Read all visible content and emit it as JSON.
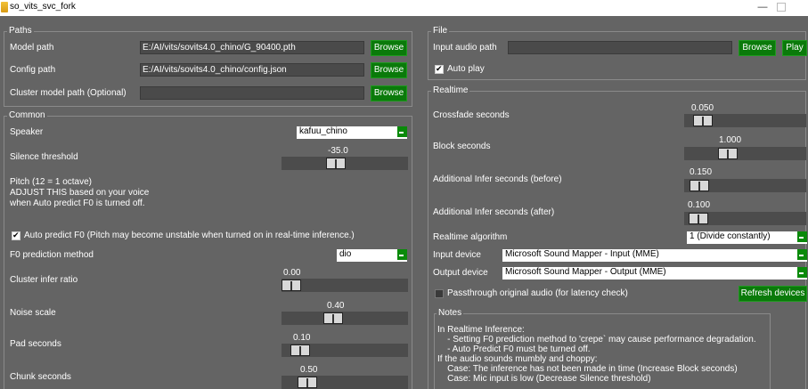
{
  "window": {
    "title": "so_vits_svc_fork",
    "minimize_glyph": "—"
  },
  "paths": {
    "title": "Paths",
    "model_path": {
      "label": "Model path",
      "value": "E:/AI/vits/sovits4.0_chino/G_90400.pth",
      "browse": "Browse"
    },
    "config_path": {
      "label": "Config path",
      "value": "E:/AI/vits/sovits4.0_chino/config.json",
      "browse": "Browse"
    },
    "cluster_model_path": {
      "label": "Cluster model path (Optional)",
      "value": "",
      "browse": "Browse"
    }
  },
  "common": {
    "title": "Common",
    "speaker": {
      "label": "Speaker",
      "value": "kafuu_chino"
    },
    "silence_threshold": {
      "label": "Silence threshold",
      "value": "-35.0",
      "fraction": 0.34
    },
    "pitch": {
      "line1": "Pitch (12 = 1 octave)",
      "line2": "ADJUST THIS based on your voice",
      "line3": "when Auto predict F0 is turned off."
    },
    "auto_predict_f0": {
      "label": "Auto predict F0 (Pitch may become unstable when turned on in real-time inference.)",
      "checked": true
    },
    "f0_method": {
      "label": "F0 prediction method",
      "value": "dio"
    },
    "cluster_infer_ratio": {
      "label": "Cluster infer ratio",
      "value": "0.00",
      "fraction": 0.0
    },
    "noise_scale": {
      "label": "Noise scale",
      "value": "0.40",
      "fraction": 0.4
    },
    "pad_seconds": {
      "label": "Pad seconds",
      "value": "0.10",
      "fraction": 0.08
    },
    "chunk_seconds": {
      "label": "Chunk seconds",
      "value": "0.50",
      "fraction": 0.14
    }
  },
  "file": {
    "title": "File",
    "input_audio_path": {
      "label": "Input audio path",
      "value": "",
      "browse": "Browse",
      "play": "Play"
    },
    "auto_play": {
      "label": "Auto play",
      "checked": true
    }
  },
  "realtime": {
    "title": "Realtime",
    "crossfade": {
      "label": "Crossfade seconds",
      "value": "0.050",
      "fraction": 0.05
    },
    "block": {
      "label": "Block seconds",
      "value": "1.000",
      "fraction": 0.25
    },
    "infer_before": {
      "label": "Additional Infer seconds (before)",
      "value": "0.150",
      "fraction": 0.0
    },
    "infer_after": {
      "label": "Additional Infer seconds (after)",
      "value": "0.100",
      "fraction": 0.0
    },
    "algorithm": {
      "label": "Realtime algorithm",
      "value": "1 (Divide constantly)"
    },
    "input_device": {
      "label": "Input device",
      "value": "Microsoft Sound Mapper - Input (MME)"
    },
    "output_device": {
      "label": "Output device",
      "value": "Microsoft Sound Mapper - Output (MME)"
    },
    "passthrough": {
      "label": "Passthrough original audio (for latency check)",
      "checked": false
    },
    "refresh": "Refresh devices"
  },
  "notes": {
    "title": "Notes",
    "lines": [
      "In Realtime Inference:",
      "    - Setting F0 prediction method to 'crepe` may cause performance degradation.",
      "    - Auto Predict F0 must be turned off.",
      "If the audio sounds mumbly and choppy:",
      "    Case: The inference has not been made in time (Increase Block seconds)",
      "    Case: Mic input is low (Decrease Silence threshold)"
    ]
  },
  "colors": {
    "background": "#646464",
    "button": "#0a7a0a",
    "combo_arrow": "#0a8a0a"
  }
}
